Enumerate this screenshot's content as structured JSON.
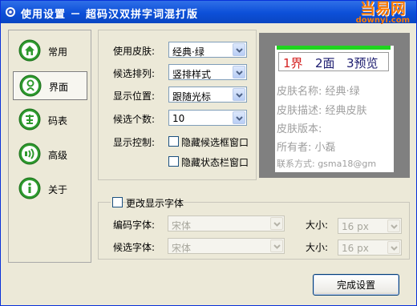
{
  "window": {
    "title": "使用设置 － 超码汉双拼字词混打版"
  },
  "watermark": {
    "cn": "当易网",
    "en": "downyi.com"
  },
  "nav": {
    "items": [
      {
        "label": "常用",
        "icon": "home-icon",
        "active": false
      },
      {
        "label": "界面",
        "icon": "skin-icon",
        "active": true
      },
      {
        "label": "码表",
        "icon": "dictionary-icon",
        "active": false
      },
      {
        "label": "高级",
        "icon": "signal-icon",
        "active": false
      },
      {
        "label": "关于",
        "icon": "info-icon",
        "active": false
      }
    ]
  },
  "settings": {
    "skin": {
      "label": "使用皮肤:",
      "value": "经典·绿"
    },
    "layout": {
      "label": "候选排列:",
      "value": "竖排样式"
    },
    "position": {
      "label": "显示位置:",
      "value": "跟随光标"
    },
    "count": {
      "label": "候选个数:",
      "value": "10"
    },
    "display_control": {
      "label": "显示控制:"
    },
    "hide_candidate_window": {
      "label": "隐藏候选框窗口",
      "checked": false
    },
    "hide_status_bar": {
      "label": "隐藏状态栏窗口",
      "checked": false
    }
  },
  "preview": {
    "candidates": [
      {
        "text": "1界",
        "color": "#d42020"
      },
      {
        "text": "2面",
        "color": "#1a1a6e"
      },
      {
        "text": "3预览",
        "color": "#1a1a6e"
      }
    ],
    "info": [
      "皮肤名称: 经典·绿",
      "皮肤描述: 经典皮肤",
      "皮肤版本:",
      "所有者: 小磊",
      "联系方式: gsma18@gm"
    ]
  },
  "font": {
    "change_label": "更改显示字体",
    "change_checked": false,
    "code_font_label": "编码字体:",
    "code_font_value": "宋体",
    "code_size_label": "大小:",
    "code_size_value": "16 px",
    "cand_font_label": "候选字体:",
    "cand_font_value": "宋体",
    "cand_size_label": "大小:",
    "cand_size_value": "16 px"
  },
  "actions": {
    "done_label": "完成设置"
  },
  "colors": {
    "accent_green": "#1ed51e",
    "titlebar": "#0c4fd8"
  }
}
